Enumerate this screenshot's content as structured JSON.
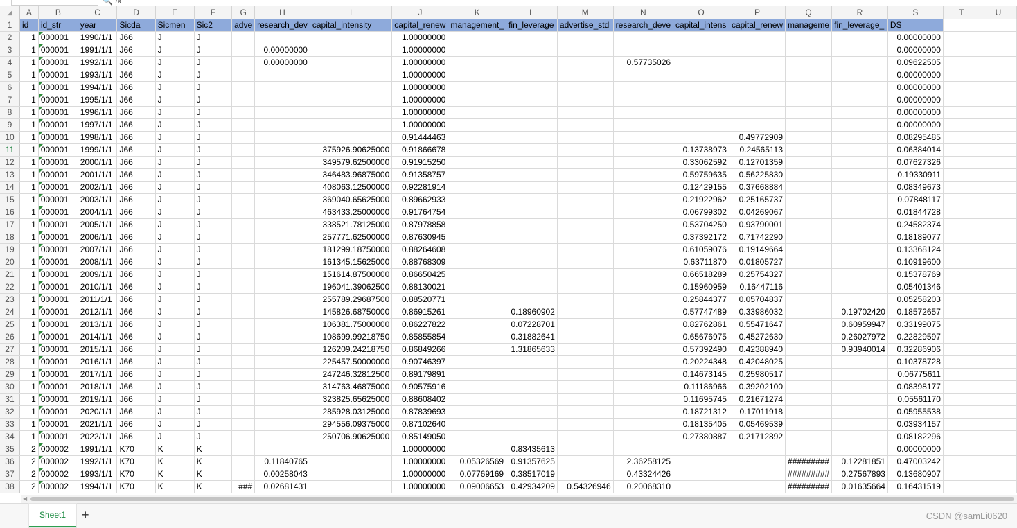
{
  "columns": [
    "A",
    "B",
    "C",
    "D",
    "E",
    "F",
    "G",
    "H",
    "I",
    "J",
    "K",
    "L",
    "M",
    "N",
    "O",
    "P",
    "Q",
    "R",
    "S",
    "T",
    "U"
  ],
  "header_row": [
    "id",
    "id_str",
    "year",
    "Sicda",
    "Sicmen",
    "Sic2",
    "adve",
    "research_dev",
    "capital_intensity",
    "capital_renew",
    "management_",
    "fin_leverage",
    "advertise_std",
    "research_deve",
    "capital_intens",
    "capital_renew",
    "manageme",
    "fin_leverage_",
    "DS",
    "",
    ""
  ],
  "rows": [
    [
      "1",
      "000001",
      "1990/1/1",
      "J66",
      "J",
      "J",
      "",
      "",
      "",
      "1.00000000",
      "",
      "",
      "",
      "",
      "",
      "",
      "",
      "",
      "0.00000000"
    ],
    [
      "1",
      "000001",
      "1991/1/1",
      "J66",
      "J",
      "J",
      "",
      "0.00000000",
      "",
      "1.00000000",
      "",
      "",
      "",
      "",
      "",
      "",
      "",
      "",
      "0.00000000"
    ],
    [
      "1",
      "000001",
      "1992/1/1",
      "J66",
      "J",
      "J",
      "",
      "0.00000000",
      "",
      "1.00000000",
      "",
      "",
      "",
      "0.57735026",
      "",
      "",
      "",
      "",
      "0.09622505"
    ],
    [
      "1",
      "000001",
      "1993/1/1",
      "J66",
      "J",
      "J",
      "",
      "",
      "",
      "1.00000000",
      "",
      "",
      "",
      "",
      "",
      "",
      "",
      "",
      "0.00000000"
    ],
    [
      "1",
      "000001",
      "1994/1/1",
      "J66",
      "J",
      "J",
      "",
      "",
      "",
      "1.00000000",
      "",
      "",
      "",
      "",
      "",
      "",
      "",
      "",
      "0.00000000"
    ],
    [
      "1",
      "000001",
      "1995/1/1",
      "J66",
      "J",
      "J",
      "",
      "",
      "",
      "1.00000000",
      "",
      "",
      "",
      "",
      "",
      "",
      "",
      "",
      "0.00000000"
    ],
    [
      "1",
      "000001",
      "1996/1/1",
      "J66",
      "J",
      "J",
      "",
      "",
      "",
      "1.00000000",
      "",
      "",
      "",
      "",
      "",
      "",
      "",
      "",
      "0.00000000"
    ],
    [
      "1",
      "000001",
      "1997/1/1",
      "J66",
      "J",
      "J",
      "",
      "",
      "",
      "1.00000000",
      "",
      "",
      "",
      "",
      "",
      "",
      "",
      "",
      "0.00000000"
    ],
    [
      "1",
      "000001",
      "1998/1/1",
      "J66",
      "J",
      "J",
      "",
      "",
      "",
      "0.91444463",
      "",
      "",
      "",
      "",
      "",
      "0.49772909",
      "",
      "",
      "0.08295485"
    ],
    [
      "1",
      "000001",
      "1999/1/1",
      "J66",
      "J",
      "J",
      "",
      "",
      "375926.90625000",
      "0.91866678",
      "",
      "",
      "",
      "",
      "0.13738973",
      "0.24565113",
      "",
      "",
      "0.06384014"
    ],
    [
      "1",
      "000001",
      "2000/1/1",
      "J66",
      "J",
      "J",
      "",
      "",
      "349579.62500000",
      "0.91915250",
      "",
      "",
      "",
      "",
      "0.33062592",
      "0.12701359",
      "",
      "",
      "0.07627326"
    ],
    [
      "1",
      "000001",
      "2001/1/1",
      "J66",
      "J",
      "J",
      "",
      "",
      "346483.96875000",
      "0.91358757",
      "",
      "",
      "",
      "",
      "0.59759635",
      "0.56225830",
      "",
      "",
      "0.19330911"
    ],
    [
      "1",
      "000001",
      "2002/1/1",
      "J66",
      "J",
      "J",
      "",
      "",
      "408063.12500000",
      "0.92281914",
      "",
      "",
      "",
      "",
      "0.12429155",
      "0.37668884",
      "",
      "",
      "0.08349673"
    ],
    [
      "1",
      "000001",
      "2003/1/1",
      "J66",
      "J",
      "J",
      "",
      "",
      "369040.65625000",
      "0.89662933",
      "",
      "",
      "",
      "",
      "0.21922962",
      "0.25165737",
      "",
      "",
      "0.07848117"
    ],
    [
      "1",
      "000001",
      "2004/1/1",
      "J66",
      "J",
      "J",
      "",
      "",
      "463433.25000000",
      "0.91764754",
      "",
      "",
      "",
      "",
      "0.06799302",
      "0.04269067",
      "",
      "",
      "0.01844728"
    ],
    [
      "1",
      "000001",
      "2005/1/1",
      "J66",
      "J",
      "J",
      "",
      "",
      "338521.78125000",
      "0.87978858",
      "",
      "",
      "",
      "",
      "0.53704250",
      "0.93790001",
      "",
      "",
      "0.24582374"
    ],
    [
      "1",
      "000001",
      "2006/1/1",
      "J66",
      "J",
      "J",
      "",
      "",
      "257771.62500000",
      "0.87630945",
      "",
      "",
      "",
      "",
      "0.37392172",
      "0.71742290",
      "",
      "",
      "0.18189077"
    ],
    [
      "1",
      "000001",
      "2007/1/1",
      "J66",
      "J",
      "J",
      "",
      "",
      "181299.18750000",
      "0.88264608",
      "",
      "",
      "",
      "",
      "0.61059076",
      "0.19149664",
      "",
      "",
      "0.13368124"
    ],
    [
      "1",
      "000001",
      "2008/1/1",
      "J66",
      "J",
      "J",
      "",
      "",
      "161345.15625000",
      "0.88768309",
      "",
      "",
      "",
      "",
      "0.63711870",
      "0.01805727",
      "",
      "",
      "0.10919600"
    ],
    [
      "1",
      "000001",
      "2009/1/1",
      "J66",
      "J",
      "J",
      "",
      "",
      "151614.87500000",
      "0.86650425",
      "",
      "",
      "",
      "",
      "0.66518289",
      "0.25754327",
      "",
      "",
      "0.15378769"
    ],
    [
      "1",
      "000001",
      "2010/1/1",
      "J66",
      "J",
      "J",
      "",
      "",
      "196041.39062500",
      "0.88130021",
      "",
      "",
      "",
      "",
      "0.15960959",
      "0.16447116",
      "",
      "",
      "0.05401346"
    ],
    [
      "1",
      "000001",
      "2011/1/1",
      "J66",
      "J",
      "J",
      "",
      "",
      "255789.29687500",
      "0.88520771",
      "",
      "",
      "",
      "",
      "0.25844377",
      "0.05704837",
      "",
      "",
      "0.05258203"
    ],
    [
      "1",
      "000001",
      "2012/1/1",
      "J66",
      "J",
      "J",
      "",
      "",
      "145826.68750000",
      "0.86915261",
      "",
      "0.18960902",
      "",
      "",
      "0.57747489",
      "0.33986032",
      "",
      "0.19702420",
      "0.18572657"
    ],
    [
      "1",
      "000001",
      "2013/1/1",
      "J66",
      "J",
      "J",
      "",
      "",
      "106381.75000000",
      "0.86227822",
      "",
      "0.07228701",
      "",
      "",
      "0.82762861",
      "0.55471647",
      "",
      "0.60959947",
      "0.33199075"
    ],
    [
      "1",
      "000001",
      "2014/1/1",
      "J66",
      "J",
      "J",
      "",
      "",
      "108699.99218750",
      "0.85855854",
      "",
      "0.31882641",
      "",
      "",
      "0.65676975",
      "0.45272630",
      "",
      "0.26027972",
      "0.22829597"
    ],
    [
      "1",
      "000001",
      "2015/1/1",
      "J66",
      "J",
      "J",
      "",
      "",
      "126209.24218750",
      "0.86849266",
      "",
      "1.31865633",
      "",
      "",
      "0.57392490",
      "0.42388940",
      "",
      "0.93940014",
      "0.32286906"
    ],
    [
      "1",
      "000001",
      "2016/1/1",
      "J66",
      "J",
      "J",
      "",
      "",
      "225457.50000000",
      "0.90746397",
      "",
      "",
      "",
      "",
      "0.20224348",
      "0.42048025",
      "",
      "",
      "0.10378728"
    ],
    [
      "1",
      "000001",
      "2017/1/1",
      "J66",
      "J",
      "J",
      "",
      "",
      "247246.32812500",
      "0.89179891",
      "",
      "",
      "",
      "",
      "0.14673145",
      "0.25980517",
      "",
      "",
      "0.06775611"
    ],
    [
      "1",
      "000001",
      "2018/1/1",
      "J66",
      "J",
      "J",
      "",
      "",
      "314763.46875000",
      "0.90575916",
      "",
      "",
      "",
      "",
      "0.11186966",
      "0.39202100",
      "",
      "",
      "0.08398177"
    ],
    [
      "1",
      "000001",
      "2019/1/1",
      "J66",
      "J",
      "J",
      "",
      "",
      "323825.65625000",
      "0.88608402",
      "",
      "",
      "",
      "",
      "0.11695745",
      "0.21671274",
      "",
      "",
      "0.05561170"
    ],
    [
      "1",
      "000001",
      "2020/1/1",
      "J66",
      "J",
      "J",
      "",
      "",
      "285928.03125000",
      "0.87839693",
      "",
      "",
      "",
      "",
      "0.18721312",
      "0.17011918",
      "",
      "",
      "0.05955538"
    ],
    [
      "1",
      "000001",
      "2021/1/1",
      "J66",
      "J",
      "J",
      "",
      "",
      "294556.09375000",
      "0.87102640",
      "",
      "",
      "",
      "",
      "0.18135405",
      "0.05469539",
      "",
      "",
      "0.03934157"
    ],
    [
      "1",
      "000001",
      "2022/1/1",
      "J66",
      "J",
      "J",
      "",
      "",
      "250706.90625000",
      "0.85149050",
      "",
      "",
      "",
      "",
      "0.27380887",
      "0.21712892",
      "",
      "",
      "0.08182296"
    ],
    [
      "2",
      "000002",
      "1991/1/1",
      "K70",
      "K",
      "K",
      "",
      "",
      "",
      "1.00000000",
      "",
      "0.83435613",
      "",
      "",
      "",
      "",
      "",
      "",
      "0.00000000"
    ],
    [
      "2",
      "000002",
      "1992/1/1",
      "K70",
      "K",
      "K",
      "",
      "0.11840765",
      "",
      "1.00000000",
      "0.05326569",
      "0.91357625",
      "",
      "2.36258125",
      "",
      "",
      "#########",
      "0.12281851",
      "0.47003242"
    ],
    [
      "2",
      "000002",
      "1993/1/1",
      "K70",
      "K",
      "K",
      "",
      "0.00258043",
      "",
      "1.00000000",
      "0.07769169",
      "0.38517019",
      "",
      "0.43324426",
      "",
      "",
      "#########",
      "0.27567893",
      "0.13680907"
    ],
    [
      "2",
      "000002",
      "1994/1/1",
      "K70",
      "K",
      "K",
      "###",
      "0.02681431",
      "",
      "1.00000000",
      "0.09006653",
      "0.42934209",
      "0.54326946",
      "0.20068310",
      "",
      "",
      "#########",
      "0.01635664",
      "0.16431519"
    ]
  ],
  "active_row": 11,
  "sheet_tab": "Sheet1",
  "add_sheet_label": "+",
  "watermark": "CSDN @samLi0620",
  "colors": {
    "header_fill": "#8eaadb",
    "tab_accent": "#2e9e4f"
  }
}
